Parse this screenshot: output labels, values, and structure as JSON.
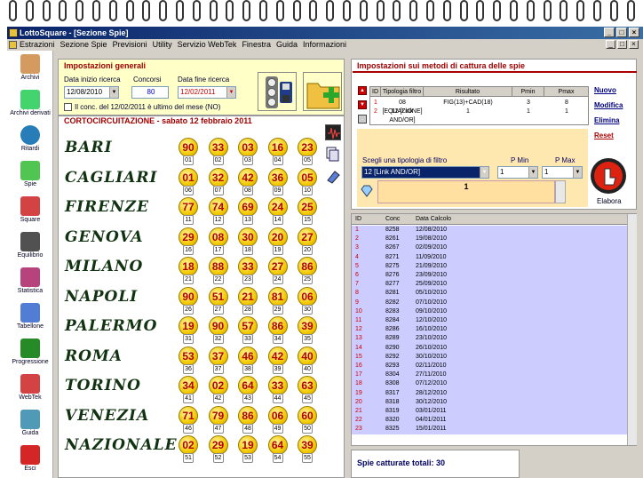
{
  "window": {
    "title": "LottoSquare - [Sezione Spie]"
  },
  "menu": [
    "Estrazioni",
    "Sezione Spie",
    "Previsioni",
    "Utility",
    "Servizio WebTek",
    "Finestra",
    "Guida",
    "Informazioni"
  ],
  "sidebar": [
    {
      "label": "Archivi",
      "icon": "pencil-icon"
    },
    {
      "label": "Archivi derivati",
      "icon": "archive-derived-icon"
    },
    {
      "label": "Ritardi",
      "icon": "clock-icon"
    },
    {
      "label": "Spie",
      "icon": "spyglass-icon"
    },
    {
      "label": "Square",
      "icon": "square-grid-icon"
    },
    {
      "label": "Equilibrio",
      "icon": "scales-icon"
    },
    {
      "label": "Statistica",
      "icon": "chart-icon"
    },
    {
      "label": "Tabellone",
      "icon": "calendar-icon"
    },
    {
      "label": "Progressione",
      "icon": "dollar-icon"
    },
    {
      "label": "WebTek",
      "icon": "webtek-icon"
    },
    {
      "label": "Guida",
      "icon": "book-icon"
    },
    {
      "label": "Esci",
      "icon": "power-icon"
    }
  ],
  "general": {
    "legend": "Impostazioni generali",
    "start_label": "Data inizio ricerca",
    "start_value": "12/08/2010",
    "concorsi_label": "Concorsi",
    "concorsi_value": "80",
    "end_label": "Data fine ricerca",
    "end_value": "12/02/2011",
    "checkbox_label": "Il conc. del 12/02/2011 è ultimo del mese (NO)"
  },
  "draw_title": "CORTOCIRCUITAZIONE - sabato 12 febbraio 2011",
  "wheels": [
    {
      "city": "BARI",
      "numbers": [
        "90",
        "33",
        "03",
        "16",
        "23"
      ],
      "pos": [
        "01",
        "02",
        "03",
        "04",
        "05"
      ]
    },
    {
      "city": "CAGLIARI",
      "numbers": [
        "01",
        "32",
        "42",
        "36",
        "05"
      ],
      "pos": [
        "06",
        "07",
        "08",
        "09",
        "10"
      ]
    },
    {
      "city": "FIRENZE",
      "numbers": [
        "77",
        "74",
        "69",
        "24",
        "25"
      ],
      "pos": [
        "11",
        "12",
        "13",
        "14",
        "15"
      ]
    },
    {
      "city": "GENOVA",
      "numbers": [
        "29",
        "08",
        "30",
        "20",
        "27"
      ],
      "pos": [
        "16",
        "17",
        "18",
        "19",
        "20"
      ]
    },
    {
      "city": "MILANO",
      "numbers": [
        "18",
        "88",
        "33",
        "27",
        "86"
      ],
      "pos": [
        "21",
        "22",
        "23",
        "24",
        "25"
      ]
    },
    {
      "city": "NAPOLI",
      "numbers": [
        "90",
        "51",
        "21",
        "81",
        "06"
      ],
      "pos": [
        "26",
        "27",
        "28",
        "29",
        "30"
      ]
    },
    {
      "city": "PALERMO",
      "numbers": [
        "19",
        "90",
        "57",
        "86",
        "39"
      ],
      "pos": [
        "31",
        "32",
        "33",
        "34",
        "35"
      ]
    },
    {
      "city": "ROMA",
      "numbers": [
        "53",
        "37",
        "46",
        "42",
        "40"
      ],
      "pos": [
        "36",
        "37",
        "38",
        "39",
        "40"
      ]
    },
    {
      "city": "TORINO",
      "numbers": [
        "34",
        "02",
        "64",
        "33",
        "63"
      ],
      "pos": [
        "41",
        "42",
        "43",
        "44",
        "45"
      ]
    },
    {
      "city": "VENEZIA",
      "numbers": [
        "71",
        "79",
        "86",
        "06",
        "60"
      ],
      "pos": [
        "46",
        "47",
        "48",
        "49",
        "50"
      ]
    },
    {
      "city": "NAZIONALE",
      "numbers": [
        "02",
        "29",
        "19",
        "64",
        "39"
      ],
      "pos": [
        "51",
        "52",
        "53",
        "54",
        "55"
      ]
    }
  ],
  "methods": {
    "legend": "Impostazioni sui metodi di cattura delle spie",
    "headers": [
      "ID",
      "Tipologia filtro",
      "Risultato",
      "Pmin",
      "Pmax"
    ],
    "rows": [
      [
        "1",
        "08 [EQUAZIONE]",
        "FIG(13)+CAD(18)",
        "3",
        "8"
      ],
      [
        "2",
        "12 [Link AND/OR]",
        "1",
        "1",
        "1"
      ]
    ],
    "buttons": [
      "Nuovo",
      "Modifica",
      "Elimina",
      "Reset"
    ],
    "filter_label": "Scegli una tipologia di filtro",
    "filter_value": "12 [Link AND/OR]",
    "pmin_label": "P Min",
    "pmin_value": "1",
    "pmax_label": "P Max",
    "pmax_value": "1",
    "result_value": "1",
    "elabora": "Elabora"
  },
  "calc": {
    "headers": [
      "ID",
      "Conc",
      "Data Calcolo"
    ],
    "rows": [
      [
        "1",
        "8258",
        "12/08/2010"
      ],
      [
        "2",
        "8261",
        "19/08/2010"
      ],
      [
        "3",
        "8267",
        "02/09/2010"
      ],
      [
        "4",
        "8271",
        "11/09/2010"
      ],
      [
        "5",
        "8275",
        "21/09/2010"
      ],
      [
        "6",
        "8276",
        "23/09/2010"
      ],
      [
        "7",
        "8277",
        "25/09/2010"
      ],
      [
        "8",
        "8281",
        "05/10/2010"
      ],
      [
        "9",
        "8282",
        "07/10/2010"
      ],
      [
        "10",
        "8283",
        "09/10/2010"
      ],
      [
        "11",
        "8284",
        "12/10/2010"
      ],
      [
        "12",
        "8286",
        "16/10/2010"
      ],
      [
        "13",
        "8289",
        "23/10/2010"
      ],
      [
        "14",
        "8290",
        "26/10/2010"
      ],
      [
        "15",
        "8292",
        "30/10/2010"
      ],
      [
        "16",
        "8293",
        "02/11/2010"
      ],
      [
        "17",
        "8304",
        "27/11/2010"
      ],
      [
        "18",
        "8308",
        "07/12/2010"
      ],
      [
        "19",
        "8317",
        "28/12/2010"
      ],
      [
        "20",
        "8318",
        "30/12/2010"
      ],
      [
        "21",
        "8319",
        "03/01/2011"
      ],
      [
        "22",
        "8320",
        "04/01/2011"
      ],
      [
        "23",
        "8325",
        "15/01/2011"
      ]
    ]
  },
  "status": "Spie catturate totali: 30"
}
